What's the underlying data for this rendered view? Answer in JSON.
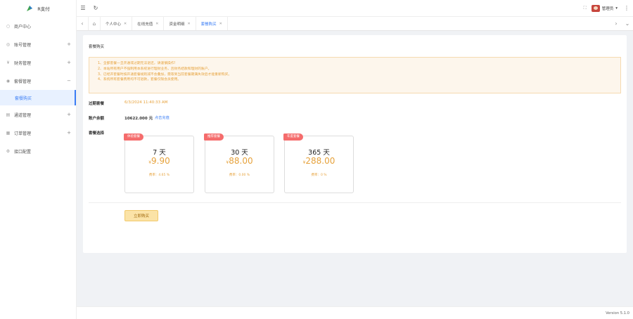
{
  "app": {
    "name": "R支付"
  },
  "sidebar": {
    "items": [
      {
        "label": "商户中心",
        "icon": "home-icon",
        "expand": ""
      },
      {
        "label": "账号管理",
        "icon": "user-icon",
        "expand": "+"
      },
      {
        "label": "财务管理",
        "icon": "finance-icon",
        "expand": "+"
      },
      {
        "label": "套餐管理",
        "icon": "package-icon",
        "expand": "−"
      },
      {
        "label": "套餐购买",
        "icon": "",
        "expand": ""
      },
      {
        "label": "通道管理",
        "icon": "channel-icon",
        "expand": "+"
      },
      {
        "label": "订单管理",
        "icon": "order-icon",
        "expand": "+"
      },
      {
        "label": "接口配置",
        "icon": "settings-icon",
        "expand": ""
      }
    ]
  },
  "topbar": {
    "menu_glyph": "☰",
    "refresh_glyph": "↻",
    "fullscreen_glyph": "⛶",
    "admin_name": "管理员",
    "dropdown_glyph": "▾",
    "more_glyph": "⋮"
  },
  "tabs": {
    "prev": "‹",
    "home": "⌂",
    "next": "›",
    "down": "⌄",
    "items": [
      {
        "label": "个人中心"
      },
      {
        "label": "在线充值"
      },
      {
        "label": "资金明细"
      },
      {
        "label": "套餐购买",
        "active": true
      }
    ]
  },
  "page": {
    "title": "套餐购买",
    "notices": [
      "1、全部套餐一旦开通或过期无法退还，请谨慎操作!",
      "2、本站所有用户不强制用本系统进行理财业务，且财务结款和理财的账户。",
      "3、已经开套餐时按开通套餐规则减不会叠加，需等到当前套餐期满失效后才能重新购买。",
      "4、系统所有套餐费用均不可退款，套餐仅限会员使用。"
    ],
    "expire_label": "过期套餐",
    "expire_value": "6/3/2024 11:40:33 AM",
    "balance_label": "账户余额",
    "balance_value": "10622.000 元",
    "recharge_label": "点击充值",
    "plans_label": "套餐选择",
    "plans": [
      {
        "badge": "体验套餐",
        "days": "7 天",
        "currency": "¥",
        "price": "9.90",
        "rate": "费率：4.65 %"
      },
      {
        "badge": "推荐套餐",
        "days": "30 天",
        "currency": "¥",
        "price": "88.00",
        "rate": "费率：0.00 %"
      },
      {
        "badge": "年度套餐",
        "days": "365 天",
        "currency": "¥",
        "price": "288.00",
        "rate": "费率：0 %"
      }
    ],
    "buy_label": "立即购买"
  },
  "footer": {
    "version": "Version 5.1.0"
  },
  "colors": {
    "accent": "#3a7df5",
    "warning": "#e6a23c",
    "badge": "#f56c6c"
  }
}
